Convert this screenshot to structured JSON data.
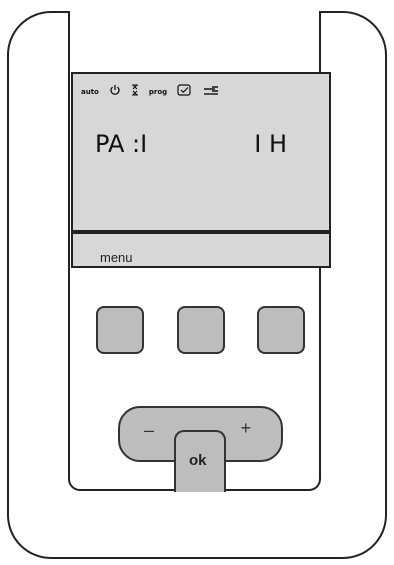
{
  "device": {
    "body_color": "#ffffff",
    "lcd_color": "#d7d7d7",
    "button_color": "#bdbdbd"
  },
  "status_icons": [
    {
      "name": "auto-icon",
      "label": "auto"
    },
    {
      "name": "power-icon"
    },
    {
      "name": "hourglass-icon"
    },
    {
      "name": "prog-icon",
      "label": "prog"
    },
    {
      "name": "check-box-icon"
    },
    {
      "name": "wrench-icon"
    }
  ],
  "display": {
    "main_text": "PA :I",
    "right_text": "I H"
  },
  "menu": {
    "label": "menu"
  },
  "controls": {
    "minus_label": "–",
    "plus_label": "+",
    "ok_label": "ok"
  }
}
